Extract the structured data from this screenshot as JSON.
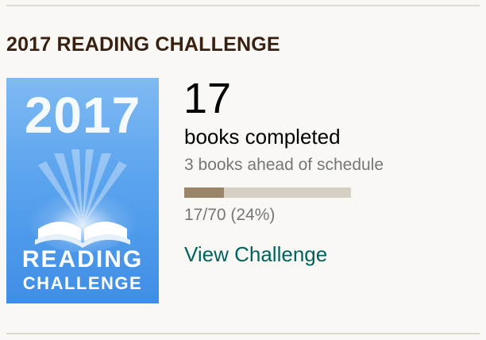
{
  "section": {
    "title": "2017 READING CHALLENGE"
  },
  "badge": {
    "year": "2017",
    "word1": "READING",
    "word2": "CHALLENGE",
    "icon": "open-book-icon",
    "colors": {
      "top": "#7fbaf2",
      "bottom": "#3f8ee6"
    }
  },
  "stats": {
    "count": "17",
    "count_label": "books completed",
    "schedule": "3 books ahead of schedule",
    "progress_text": "17/70 (24%)",
    "progress_fraction": 0.24
  },
  "link": {
    "label": "View Challenge"
  },
  "colors": {
    "title": "#382110",
    "link": "#00635d",
    "progress_fill": "#9b8568",
    "progress_track": "#d6d0c4"
  }
}
